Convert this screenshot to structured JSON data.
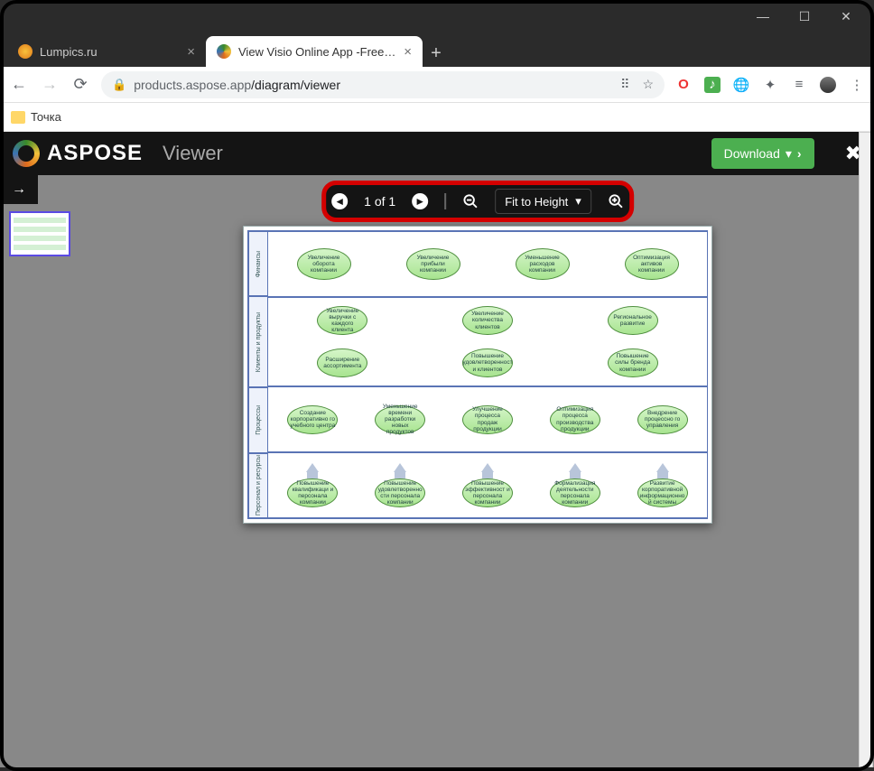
{
  "window": {
    "minimize": "—",
    "maximize": "☐",
    "close": "✕"
  },
  "tabs": {
    "t1": {
      "label": "Lumpics.ru"
    },
    "t2": {
      "label": "View Visio Online App -Free Onli"
    },
    "new": "+"
  },
  "nav": {
    "back": "←",
    "forward": "→",
    "reload": "⟳"
  },
  "address": {
    "lock": "🔒",
    "domain": "products.aspose.app",
    "path": "/diagram/viewer"
  },
  "addr_icons": {
    "translate": "⠿",
    "star": "☆"
  },
  "ext": {
    "opera": "O",
    "music": "♪",
    "globe": "🌐",
    "puzzle": "✦",
    "reader": "≡",
    "avatar": "●",
    "menu": "⋮"
  },
  "bookmark": {
    "label": "Точка"
  },
  "app": {
    "brand": "ASPOSE",
    "viewer": "Viewer",
    "download": "Download",
    "close": "✖"
  },
  "controls": {
    "page_label": "1 of 1",
    "zoom_mode": "Fit to Height"
  },
  "lanes": {
    "h1": "Финансы",
    "h2": "Клиенты и продукты",
    "h3": "Процессы",
    "h4": "Персонал и ресурсы"
  },
  "nodes": {
    "r1": [
      "Увеличение оборота компании",
      "Увеличение прибыли компании",
      "Уменьшение расходов компании",
      "Оптимизация активов компании"
    ],
    "r2a": [
      "Увеличение выручки с каждого клиента",
      "Увеличение количества клиентов",
      "Региональное развитие"
    ],
    "r2b": [
      "Расширение ассортимента",
      "Повышение удовлетворенност и клиентов",
      "Повышение силы бренда компании"
    ],
    "r3": [
      "Создание корпоративно го учебного центра",
      "Уменьшение времени разработки новых продуктов",
      "Улучшение процесса продаж продукции",
      "Оптимизация процесса производства продукции",
      "Внедрение процессно го управления"
    ],
    "r4": [
      "Повышение квалификаци и персонала компании",
      "Повышение удовлетворенно сти персонала компании",
      "Повышение эффективност и персонала компании",
      "Формализация деятельности персонала компании",
      "Развитие корпоративной информационно й системы"
    ]
  }
}
